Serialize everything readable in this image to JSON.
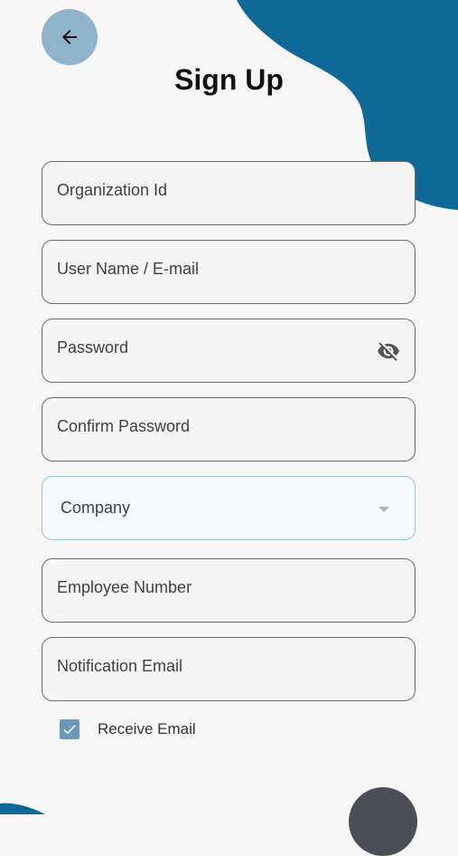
{
  "header": {
    "title": "Sign Up"
  },
  "icons": {
    "back": "arrow-left-icon",
    "visibility": "eye-off-icon",
    "dropdown": "chevron-down-icon",
    "check": "check-icon"
  },
  "colors": {
    "accent": "#0f6896",
    "back_button_bg": "#8fb3cb",
    "checkbox": "#6c98b8",
    "fab": "#4a5058"
  },
  "form": {
    "fields": [
      {
        "label": "Organization Id"
      },
      {
        "label": "User Name / E-mail"
      },
      {
        "label": "Password"
      },
      {
        "label": "Confirm Password"
      },
      {
        "label": "Company"
      },
      {
        "label": "Employee Number"
      },
      {
        "label": "Notification Email"
      }
    ],
    "receive_email": {
      "label": "Receive Email",
      "checked": true
    }
  }
}
